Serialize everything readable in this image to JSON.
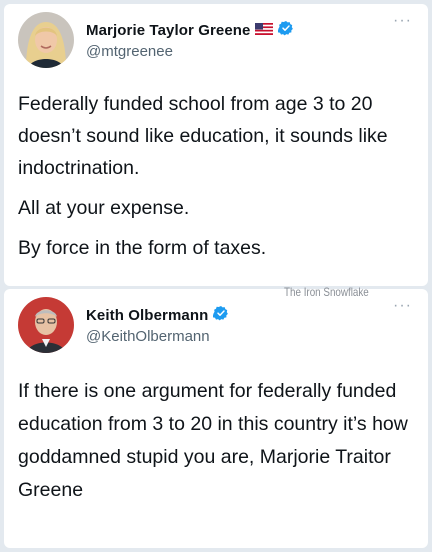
{
  "tweets": [
    {
      "name": "Marjorie Taylor Greene",
      "handle": "@mtgreenee",
      "badges": [
        "us-flag-icon",
        "verified-badge-icon"
      ],
      "more_label": "···",
      "paragraphs": [
        "Federally funded school from age 3 to 20 doesn’t sound like education, it sounds like indoctrination.",
        "All at your expense.",
        "By force in the form of taxes."
      ]
    },
    {
      "name": "Keith Olbermann",
      "handle": "@KeithOlbermann",
      "badges": [
        "verified-badge-icon"
      ],
      "more_label": "···",
      "paragraphs": [
        "If there is one argument for federally funded education from 3 to 20 in this country it’s how goddamned stupid you are, Marjorie Traitor Greene"
      ]
    }
  ],
  "watermark": "The Iron Snowflake",
  "colors": {
    "verified": "#1d9bf0",
    "text": "#0f1419",
    "secondary": "#536471"
  }
}
